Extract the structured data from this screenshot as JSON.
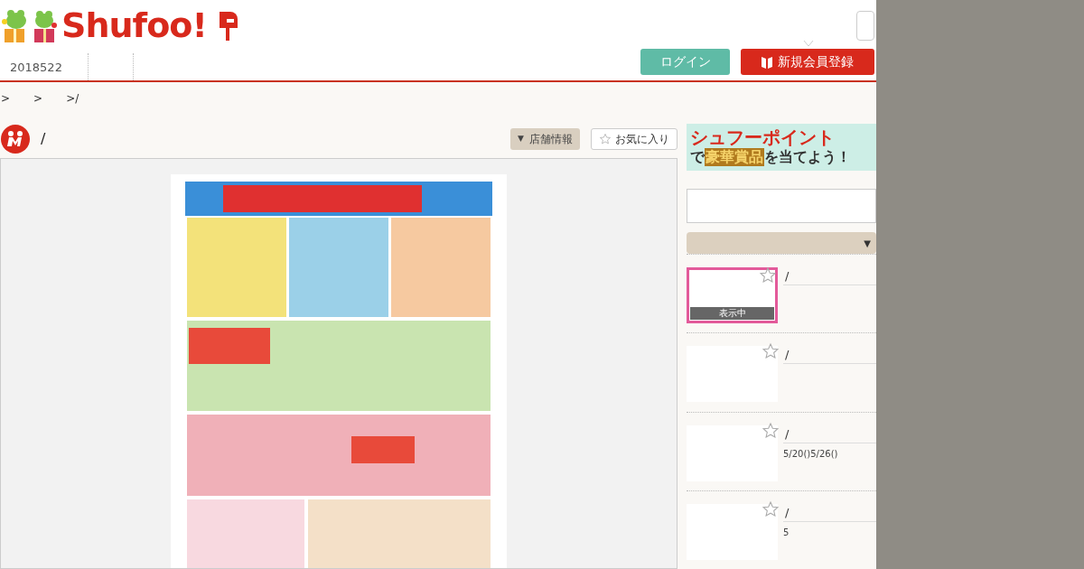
{
  "header": {
    "logo": "Shufoo!",
    "nav": [
      "2018522"
    ],
    "login_button": "ログイン",
    "register_button": "新規会員登録"
  },
  "breadcrumb": [
    ">",
    ">",
    ">/"
  ],
  "store": {
    "name": "/",
    "info_button": "店舗情報",
    "info_caret": "▼",
    "favorite_button": "お気に入り"
  },
  "flyer_viewer": {
    "kind": "picture"
  },
  "sidebar": {
    "banner": {
      "line1": "シュフーポイント",
      "line2_highlight": "で",
      "line2_gold": "豪華賞品",
      "line2_rest": "を当てよう！"
    },
    "dropdown_caret": "▼",
    "flyers": [
      {
        "title": "/",
        "selected": true,
        "badge": "表示中"
      },
      {
        "title": "/",
        "selected": false
      },
      {
        "title": "/",
        "selected": false,
        "note": "5/20()5/26()"
      },
      {
        "title": "/",
        "selected": false,
        "note": "5"
      }
    ]
  }
}
